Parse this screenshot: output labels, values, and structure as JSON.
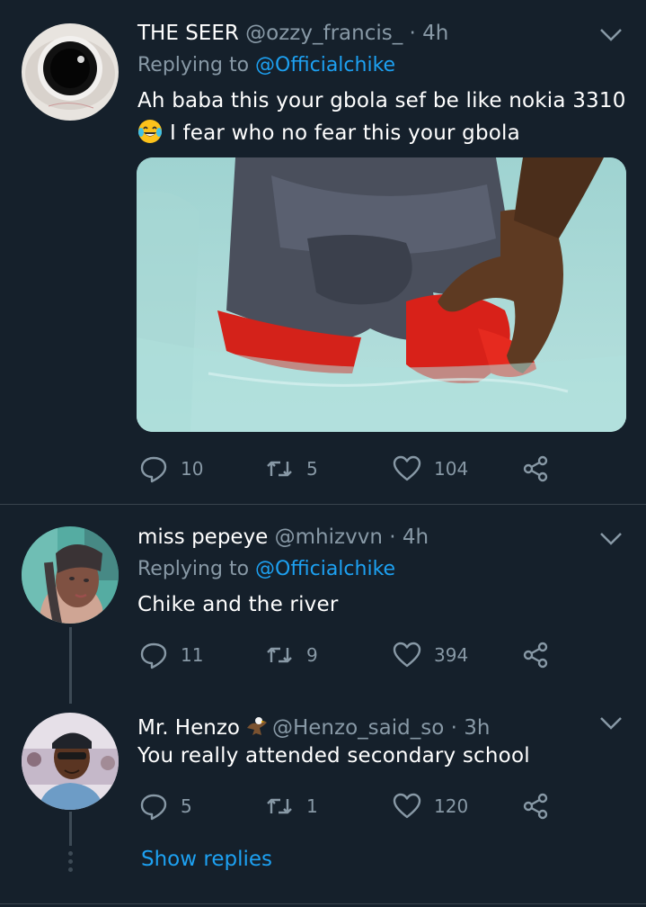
{
  "tweets": [
    {
      "name": "THE SEER",
      "handle": "@ozzy_francis_",
      "time": "· 4h",
      "replying_prefix": "Replying to",
      "replying_to": "@Officialchike",
      "text_line1": "Ah baba this your gbola sef be like nokia 3310",
      "text_line2": "I fear who no fear this your gbola",
      "emoji": "face-with-tears-of-joy",
      "replies": "10",
      "retweets": "5",
      "likes": "104"
    },
    {
      "name": "miss pepeye",
      "handle": "@mhizvvn",
      "time": "· 4h",
      "replying_prefix": "Replying to",
      "replying_to": "@Officialchike",
      "text_line1": "Chike and the river",
      "replies": "11",
      "retweets": "9",
      "likes": "394"
    },
    {
      "name": "Mr. Henzo",
      "handle": "@Henzo_said_so",
      "time": "· 3h",
      "text_line1": "You really attended secondary school",
      "emoji": "eagle",
      "replies": "5",
      "retweets": "1",
      "likes": "120"
    }
  ],
  "show_replies": "Show replies",
  "colors": {
    "background": "#15202b",
    "secondary_text": "#8899a6",
    "link": "#1da1f2",
    "divider": "#38444d"
  }
}
